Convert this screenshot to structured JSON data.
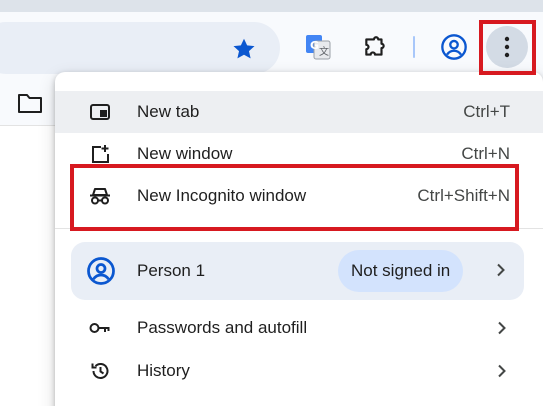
{
  "toolbar": {
    "icons": [
      "bookmark-star-icon",
      "google-translate-icon",
      "extensions-icon",
      "profile-icon",
      "more-vert-icon"
    ],
    "accent": "#0b57d0"
  },
  "bookmarks_bar": {
    "icon": "folder-icon"
  },
  "menu": {
    "items": [
      {
        "label": "New tab",
        "shortcut": "Ctrl+T",
        "icon": "new-tab-icon"
      },
      {
        "label": "New window",
        "shortcut": "Ctrl+N",
        "icon": "new-window-icon"
      },
      {
        "label": "New Incognito window",
        "shortcut": "Ctrl+Shift+N",
        "icon": "incognito-icon"
      }
    ],
    "profile": {
      "name": "Person 1",
      "status": "Not signed in",
      "icon": "account-circle-icon"
    },
    "more": [
      {
        "label": "Passwords and autofill",
        "icon": "key-icon"
      },
      {
        "label": "History",
        "icon": "history-icon"
      }
    ]
  },
  "highlight_color": "#d71920"
}
